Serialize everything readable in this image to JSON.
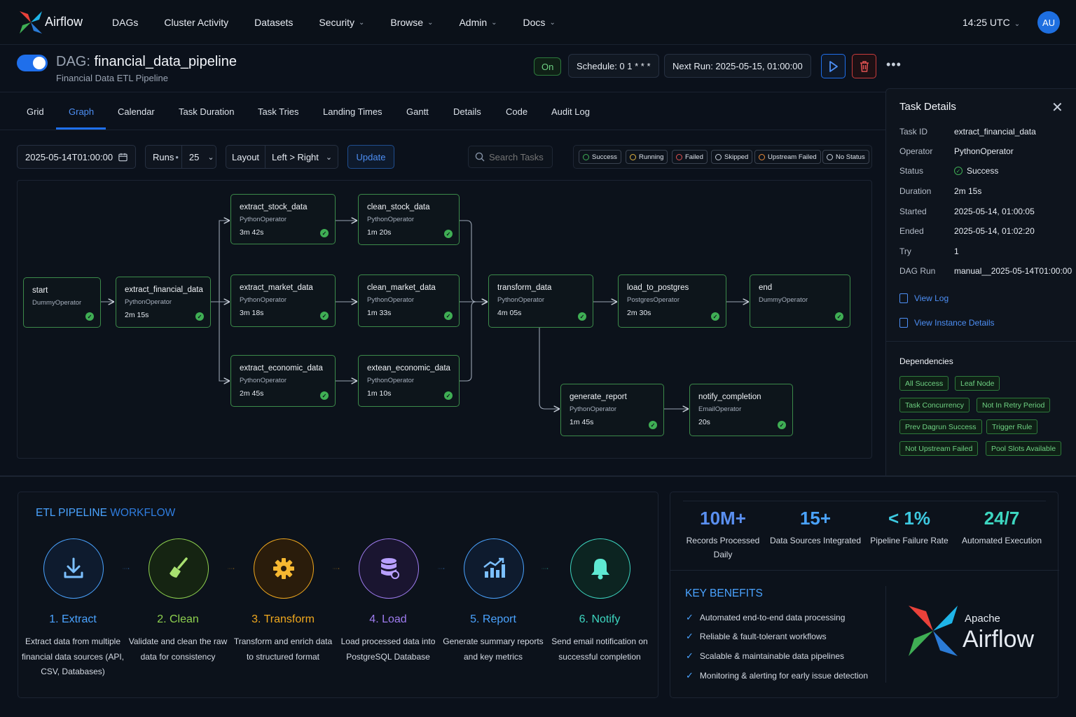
{
  "nav": {
    "brand": "Airflow",
    "items": [
      {
        "label": "DAGs",
        "dropdown": false
      },
      {
        "label": "Cluster Activity",
        "dropdown": false
      },
      {
        "label": "Datasets",
        "dropdown": false
      },
      {
        "label": "Security",
        "dropdown": true
      },
      {
        "label": "Browse",
        "dropdown": true
      },
      {
        "label": "Admin",
        "dropdown": true
      },
      {
        "label": "Docs",
        "dropdown": true
      }
    ],
    "time": "14:25 UTC",
    "avatar": "AU"
  },
  "dag": {
    "prefix": "DAG:",
    "name": "financial_data_pipeline",
    "subtitle": "Financial Data ETL Pipeline",
    "state_pill": "On",
    "schedule": "Schedule: 0 1 * * *",
    "next_run": "Next Run: 2025-05-15, 01:00:00"
  },
  "tabs": [
    "Grid",
    "Graph",
    "Calendar",
    "Task Duration",
    "Task Tries",
    "Landing Times",
    "Gantt",
    "Details",
    "Code",
    "Audit Log"
  ],
  "active_tab": "Graph",
  "toolbar": {
    "run_date": "2025-05-14T01:00:00",
    "runs_label": "Runs",
    "runs_value": "25",
    "layout_label": "Layout",
    "layout_value": "Left > Right",
    "update_label": "Update",
    "search_placeholder": "Search Tasks"
  },
  "legend": [
    {
      "label": "Success",
      "color": "#3fae54"
    },
    {
      "label": "Running",
      "color": "#e0b341"
    },
    {
      "label": "Failed",
      "color": "#e05252"
    },
    {
      "label": "Skipped",
      "color": "#c7cfdb"
    },
    {
      "label": "Upstream Failed",
      "color": "#e88a3a"
    },
    {
      "label": "No Status",
      "color": "#c7cfdb"
    }
  ],
  "nodes": [
    {
      "id": "start",
      "name": "start",
      "operator": "DummyOperator",
      "duration": "",
      "status": "success"
    },
    {
      "id": "extract_financial_data",
      "name": "extract_financial_data",
      "operator": "PythonOperator",
      "duration": "2m 15s",
      "status": "success"
    },
    {
      "id": "extract_stock_data",
      "name": "extract_stock_data",
      "operator": "PythonOperator",
      "duration": "3m 42s",
      "status": "success"
    },
    {
      "id": "extract_market_data",
      "name": "extract_market_data",
      "operator": "PythonOperator",
      "duration": "3m 18s",
      "status": "success"
    },
    {
      "id": "extract_economic_data",
      "name": "extract_economic_data",
      "operator": "PythonOperator",
      "duration": "2m 45s",
      "status": "success"
    },
    {
      "id": "clean_stock_data",
      "name": "clean_stock_data",
      "operator": "PythonOperator",
      "duration": "1m 20s",
      "status": "success"
    },
    {
      "id": "clean_market_data",
      "name": "clean_market_data",
      "operator": "PythonOperator",
      "duration": "1m 33s",
      "status": "success"
    },
    {
      "id": "extean_economic_data",
      "name": "extean_economic_data",
      "operator": "PythonOperator",
      "duration": "1m 10s",
      "status": "success"
    },
    {
      "id": "transform_data",
      "name": "transform_data",
      "operator": "PythonOperator",
      "duration": "4m 05s",
      "status": "success"
    },
    {
      "id": "load_to_postgres",
      "name": "load_to_postgres",
      "operator": "PostgresOperator",
      "duration": "2m 30s",
      "status": "success"
    },
    {
      "id": "end",
      "name": "end",
      "operator": "DummyOperator",
      "duration": "",
      "status": "success"
    },
    {
      "id": "generate_report",
      "name": "generate_report",
      "operator": "PythonOperator",
      "duration": "1m 45s",
      "status": "success"
    },
    {
      "id": "notify_completion",
      "name": "notify_completion",
      "operator": "EmailOperator",
      "duration": "20s",
      "status": "success"
    }
  ],
  "task_details": {
    "title": "Task Details",
    "rows": [
      {
        "key": "Task ID",
        "value": "extract_financial_data"
      },
      {
        "key": "Operator",
        "value": "PythonOperator"
      },
      {
        "key": "Status",
        "value": "Success"
      },
      {
        "key": "Duration",
        "value": "2m 15s"
      },
      {
        "key": "Started",
        "value": "2025-05-14, 01:00:05"
      },
      {
        "key": "Ended",
        "value": "2025-05-14, 01:02:20"
      },
      {
        "key": "Try",
        "value": "1"
      },
      {
        "key": "DAG Run",
        "value": "manual__2025-05-14T01:00:00"
      }
    ],
    "view_log": "View Log",
    "view_instance": "View Instance Details",
    "dependencies_title": "Dependencies",
    "dependencies": [
      "All Success",
      "Leaf Node",
      "Task Concurrency",
      "Not In Retry Period",
      "Prev Dagrun Success",
      "Trigger Rule",
      "Not Upstream Failed",
      "Pool Slots Available"
    ]
  },
  "etl": {
    "title_a": "ETL PIPELINE",
    "title_b": "WORKFLOW",
    "steps": [
      {
        "name": "1. Extract",
        "desc": "Extract data from multiple financial data sources (API, CSV, Databases)",
        "color": "#4aa3ff",
        "icon": "download-icon"
      },
      {
        "name": "2. Clean",
        "desc": "Validate and clean the raw data for consistency",
        "color": "#8ed14f",
        "icon": "broom-icon"
      },
      {
        "name": "3. Transform",
        "desc": "Transform and enrich data to structured format",
        "color": "#f0a81e",
        "icon": "gear-icon"
      },
      {
        "name": "4. Load",
        "desc": "Load processed data into PostgreSQL Database",
        "color": "#9f7cf0",
        "icon": "database-icon"
      },
      {
        "name": "5. Report",
        "desc": "Generate summary reports and key metrics",
        "color": "#4aa3ff",
        "icon": "chart-icon"
      },
      {
        "name": "6. Notify",
        "desc": "Send email notification on successful completion",
        "color": "#3dd6c0",
        "icon": "bell-icon"
      }
    ]
  },
  "stats": [
    {
      "value": "10M+",
      "label": "Records Processed Daily",
      "color": "#5a8ff0"
    },
    {
      "value": "15+",
      "label": "Data Sources Integrated",
      "color": "#4aa3ff"
    },
    {
      "value": "< 1%",
      "label": "Pipeline Failure Rate",
      "color": "#3dc9e0"
    },
    {
      "value": "24/7",
      "label": "Automated Execution",
      "color": "#3dd6c0"
    }
  ],
  "benefits": {
    "title": "KEY BENEFITS",
    "items": [
      "Automated end-to-end data processing",
      "Reliable & fault-tolerant workflows",
      "Scalable & maintainable data pipelines",
      "Monitoring & alerting for early issue detection"
    ]
  },
  "branding": {
    "line1": "Apache",
    "line2": "Airflow"
  }
}
